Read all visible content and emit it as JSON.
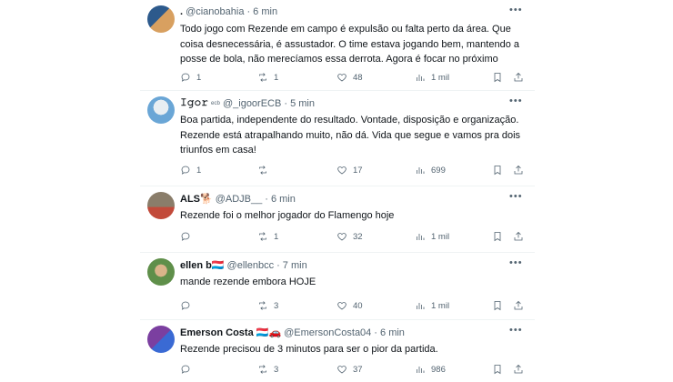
{
  "tweets": [
    {
      "name": ".",
      "handle": "@cianobahia",
      "time": "· 6 min",
      "text": "Todo jogo com Rezende em campo é expulsão ou falta perto da área. Que coisa desnecessária, é assustador. O time estava jogando bem, mantendo a posse de bola, não merecíamos essa derrota. Agora é focar no próximo",
      "replies": "1",
      "retweets": "1",
      "likes": "48",
      "views": "1 mil",
      "avatar_colors": [
        "#2d5a8c",
        "#d8a060"
      ]
    },
    {
      "name": "𝙸𝚐𝚘𝚛",
      "badge": "ᵉᶜᵇ",
      "handle": "@_igoorECB",
      "time": "· 5 min",
      "text": "Boa partida, independente do resultado. Vontade, disposição e organização. Rezende está atrapalhando muito, não dá. Vida que segue e vamos pra dois triunfos em casa!",
      "replies": "1",
      "retweets": "",
      "likes": "17",
      "views": "699",
      "avatar_colors": [
        "#6aa6d6",
        "#e8eef2"
      ]
    },
    {
      "name": "ALS🐕",
      "handle": "@ADJB__",
      "time": "· 6 min",
      "text": "Rezende foi o melhor jogador do Flamengo hoje",
      "replies": "",
      "retweets": "1",
      "likes": "32",
      "views": "1 mil",
      "avatar_colors": [
        "#8a7d6a",
        "#c24a3a"
      ]
    },
    {
      "name": "ellen b🇱🇺",
      "handle": "@ellenbcc",
      "time": "· 7 min",
      "text": "mande rezende embora HOJE",
      "replies": "",
      "retweets": "3",
      "likes": "40",
      "views": "1 mil",
      "avatar_colors": [
        "#5f8f4a",
        "#d9b48a"
      ]
    },
    {
      "name": "Emerson Costa 🇱🇺🚗",
      "handle": "@EmersonCosta04",
      "time": "· 6 min",
      "text": "Rezende precisou de 3 minutos para ser o pior da partida.",
      "replies": "",
      "retweets": "3",
      "likes": "37",
      "views": "986",
      "avatar_colors": [
        "#7b3fa0",
        "#3a6ad4"
      ]
    }
  ]
}
